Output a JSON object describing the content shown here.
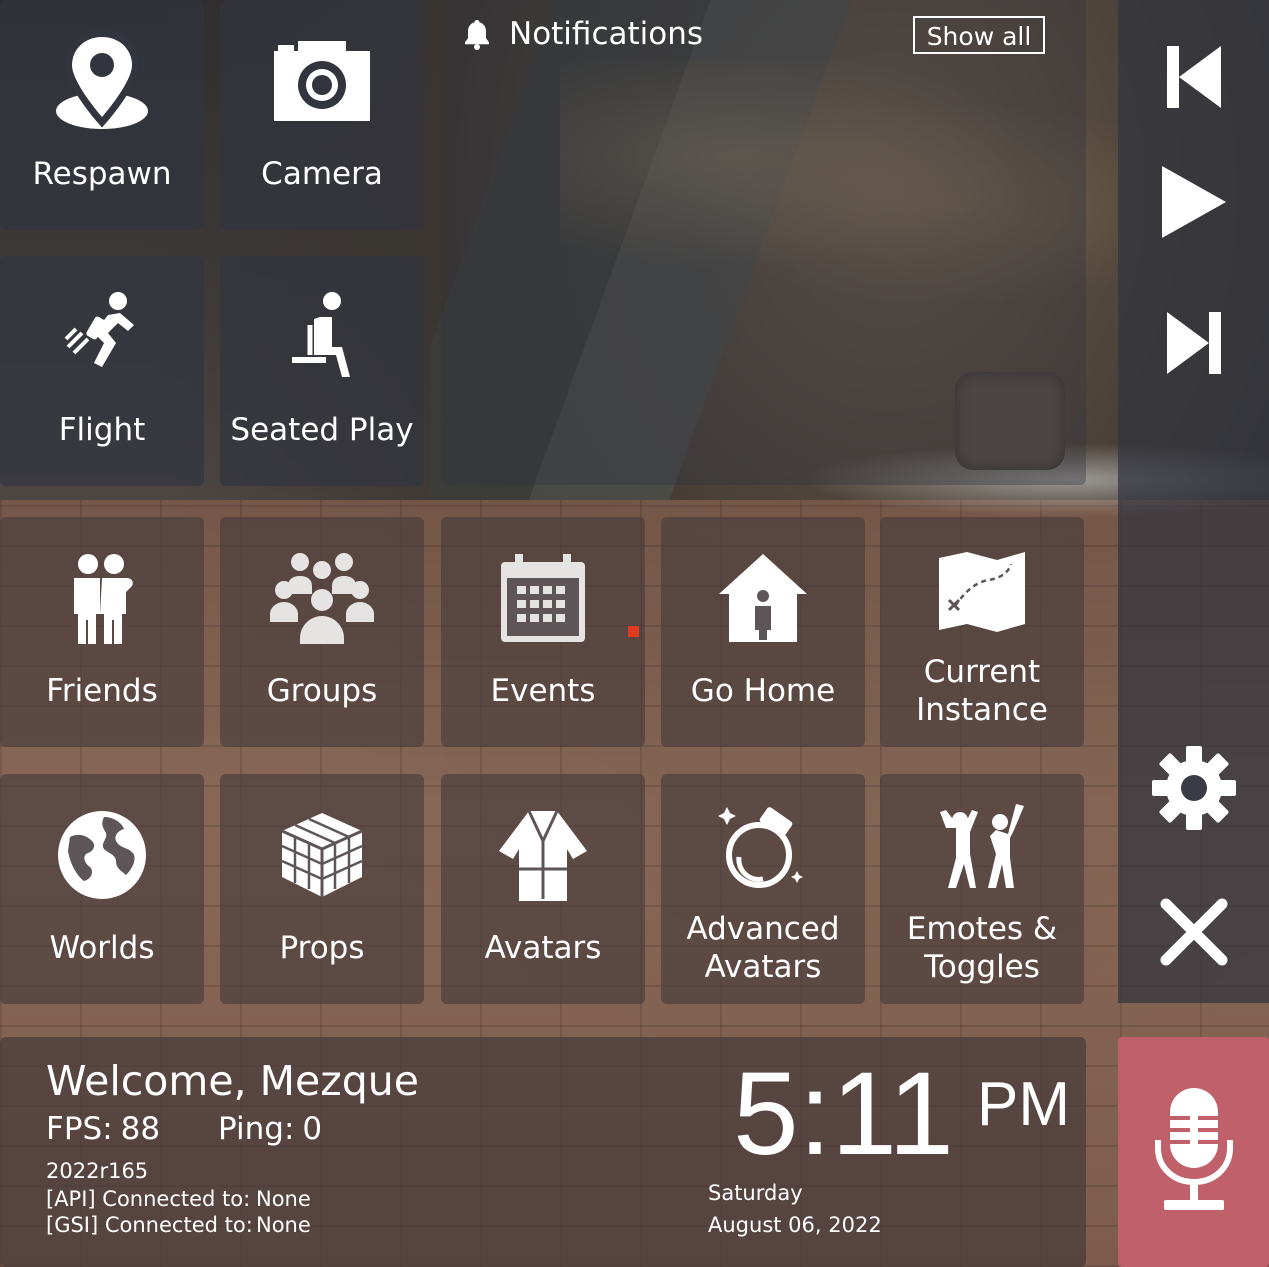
{
  "tiles": {
    "respawn": "Respawn",
    "camera": "Camera",
    "flight": "Flight",
    "seated": "Seated Play",
    "friends": "Friends",
    "groups": "Groups",
    "events": "Events",
    "home": "Go Home",
    "instance_1": "Current",
    "instance_2": "Instance",
    "worlds": "Worlds",
    "props": "Props",
    "avatars": "Avatars",
    "adv_1": "Advanced",
    "adv_2": "Avatars",
    "emotes_1": "Emotes &",
    "emotes_2": "Toggles"
  },
  "notifications": {
    "title": "Notifications",
    "show_all": "Show all"
  },
  "info": {
    "welcome": "Welcome, Mezque",
    "fps_label": "FPS:",
    "fps_value": "88",
    "ping_label": "Ping:",
    "ping_value": "0",
    "version": "2022r165",
    "api_label": "[API] Connected to:",
    "api_value": "None",
    "gsi_label": "[GSI] Connected to:",
    "gsi_value": "None",
    "time": "5:11",
    "ampm": "PM",
    "day": "Saturday",
    "date": "August 06, 2022"
  },
  "icons": {
    "respawn": "location-pin-icon",
    "camera": "camera-icon",
    "flight": "jetpack-flight-icon",
    "seated": "seated-person-icon",
    "friends": "friends-icon",
    "groups": "groups-icon",
    "events": "calendar-icon",
    "home": "home-icon",
    "instance": "treasure-map-icon",
    "worlds": "globe-icon",
    "props": "cube-icon",
    "avatars": "robe-icon",
    "advanced": "potion-icon",
    "emotes": "dancing-icon",
    "media": [
      "skip-previous-icon",
      "play-icon",
      "skip-next-icon"
    ],
    "settings": "gear-icon",
    "close": "close-icon",
    "mic": "microphone-icon",
    "notif": "bell-icon"
  },
  "colors": {
    "mic_bg": "#c0606a",
    "tile_bg": "#32343e"
  }
}
